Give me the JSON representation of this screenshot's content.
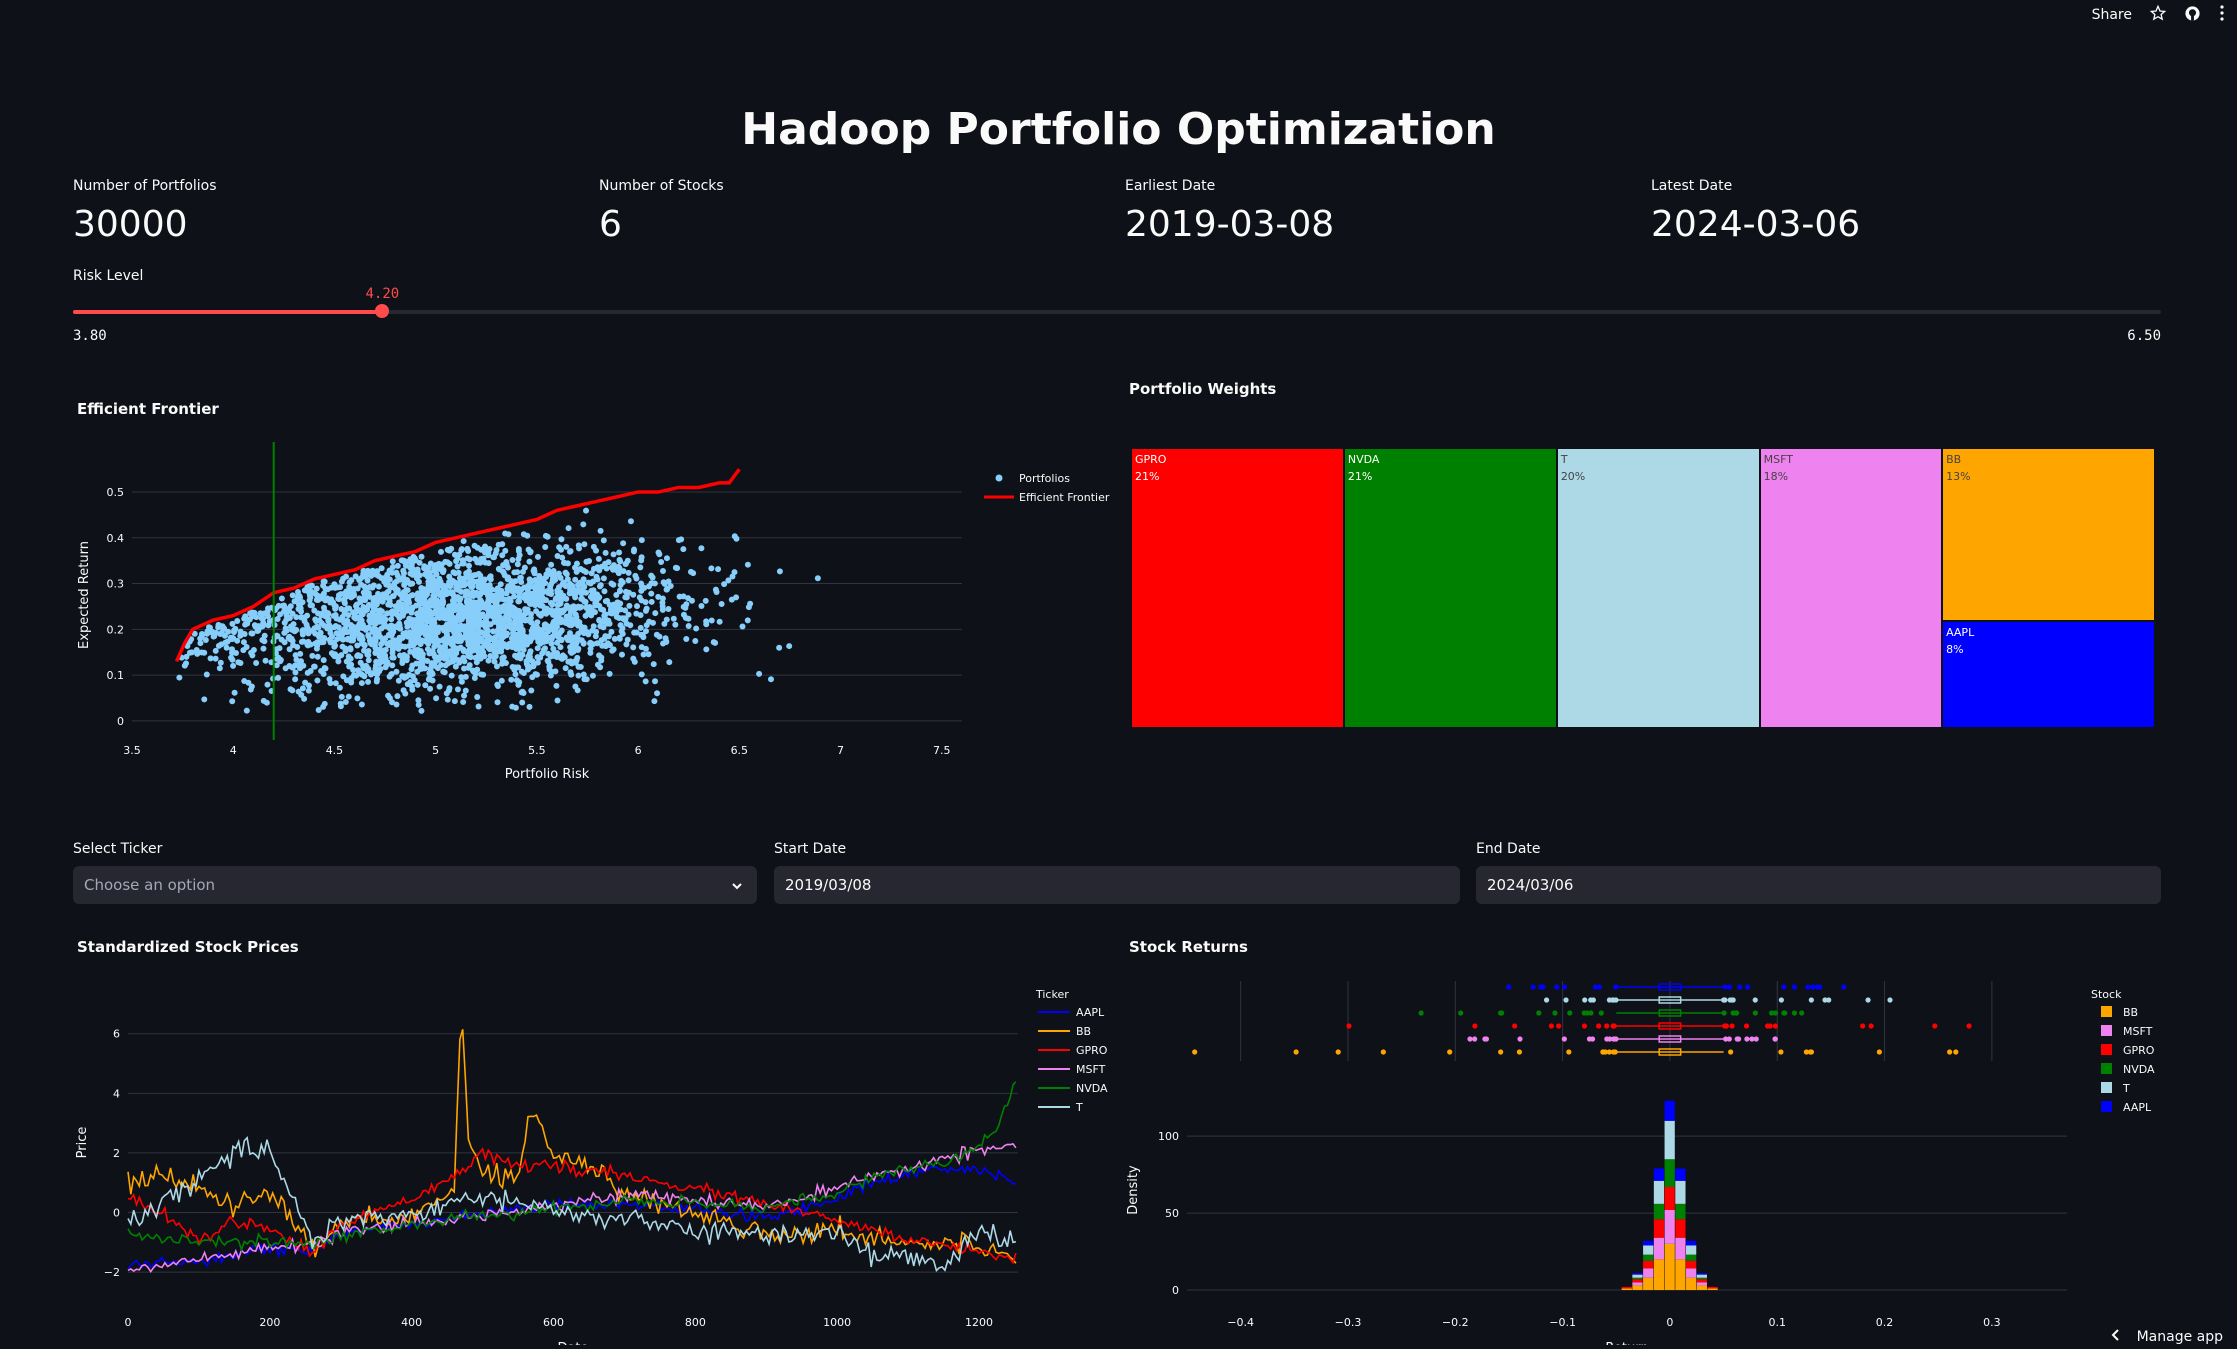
{
  "topbar": {
    "share": "Share",
    "star_icon": "star-icon",
    "github_icon": "github-icon",
    "menu_icon": "kebab-menu-icon"
  },
  "title": "Hadoop Portfolio Optimization",
  "metrics": [
    {
      "label": "Number of Portfolios",
      "value": "30000"
    },
    {
      "label": "Number of Stocks",
      "value": "6"
    },
    {
      "label": "Earliest Date",
      "value": "2019-03-08"
    },
    {
      "label": "Latest Date",
      "value": "2024-03-06"
    }
  ],
  "slider": {
    "label": "Risk Level",
    "min": "3.80",
    "max": "6.50",
    "value": "4.20",
    "value_num": 4.2,
    "min_num": 3.8,
    "max_num": 6.5
  },
  "efficient_frontier": {
    "title": "Efficient Frontier"
  },
  "portfolio_weights": {
    "title": "Portfolio Weights"
  },
  "controls": {
    "ticker_label": "Select Ticker",
    "ticker_placeholder": "Choose an option",
    "start_label": "Start Date",
    "start_value": "2019/03/08",
    "end_label": "End Date",
    "end_value": "2024/03/06"
  },
  "prices": {
    "title": "Standardized Stock Prices"
  },
  "returns": {
    "title": "Stock Returns"
  },
  "footer": {
    "manage": "Manage app"
  },
  "colors": {
    "AAPL": "#0000ff",
    "BB": "#ffa500",
    "GPRO": "#ff0000",
    "MSFT": "#ee82ee",
    "NVDA": "#008000",
    "T": "#add8e6",
    "accent": "#ff4b4b",
    "portfolio": "#87cefa"
  },
  "chart_data": [
    {
      "type": "scatter",
      "title": "",
      "xlabel": "Portfolio Risk",
      "ylabel": "Expected Return",
      "xlim": [
        3.5,
        7.6
      ],
      "ylim": [
        -0.02,
        0.57
      ],
      "xticks": [
        "3.5",
        "4",
        "4.5",
        "5",
        "5.5",
        "6",
        "6.5",
        "7",
        "7.5"
      ],
      "yticks": [
        "0",
        "0.1",
        "0.2",
        "0.3",
        "0.4",
        "0.5"
      ],
      "legend": [
        "Portfolios",
        "Efficient Frontier"
      ],
      "legend_position": "top-right",
      "vline_x": 4.2,
      "frontier": {
        "x": [
          3.72,
          3.76,
          3.8,
          3.9,
          4.0,
          4.1,
          4.2,
          4.3,
          4.4,
          4.5,
          4.6,
          4.7,
          4.8,
          4.9,
          5.0,
          5.1,
          5.2,
          5.3,
          5.4,
          5.5,
          5.6,
          5.7,
          5.8,
          5.9,
          6.0,
          6.1,
          6.2,
          6.3,
          6.4,
          6.45,
          6.5
        ],
        "y": [
          0.13,
          0.17,
          0.2,
          0.22,
          0.23,
          0.25,
          0.28,
          0.29,
          0.31,
          0.32,
          0.33,
          0.35,
          0.36,
          0.37,
          0.39,
          0.4,
          0.41,
          0.42,
          0.43,
          0.44,
          0.46,
          0.47,
          0.48,
          0.49,
          0.5,
          0.5,
          0.51,
          0.51,
          0.52,
          0.52,
          0.55
        ]
      },
      "series": [
        {
          "name": "Portfolios",
          "values": "30000 random portfolios (risk 3.7–7.4, return 0.0–0.5)"
        }
      ]
    },
    {
      "type": "treemap",
      "labels": [
        "GPRO",
        "NVDA",
        "T",
        "MSFT",
        "BB",
        "AAPL"
      ],
      "values": [
        21,
        21,
        20,
        18,
        13,
        8
      ],
      "value_labels": [
        "21%",
        "21%",
        "20%",
        "18%",
        "13%",
        "8%"
      ]
    },
    {
      "type": "line",
      "title": "",
      "xlabel": "Date",
      "ylabel": "Price",
      "xlim": [
        0,
        1255
      ],
      "ylim": [
        -2.6,
        7.3
      ],
      "xticks": [
        "0",
        "200",
        "400",
        "600",
        "800",
        "1000",
        "1200"
      ],
      "yticks": [
        "−2",
        "0",
        "2",
        "4",
        "6"
      ],
      "legend_title": "Ticker",
      "series": [
        {
          "name": "AAPL",
          "x": [
            0,
            100,
            200,
            260,
            300,
            400,
            500,
            600,
            700,
            800,
            900,
            1000,
            1050,
            1100,
            1150,
            1200,
            1250
          ],
          "y": [
            -1.8,
            -1.6,
            -1.2,
            -1.3,
            -0.7,
            -0.4,
            0,
            0.3,
            0.3,
            0.1,
            -0.2,
            0.5,
            1.0,
            1.3,
            1.5,
            1.4,
            1.1
          ]
        },
        {
          "name": "BB",
          "x": [
            0,
            50,
            100,
            150,
            200,
            240,
            260,
            300,
            400,
            460,
            470,
            480,
            500,
            550,
            570,
            600,
            650,
            700,
            800,
            900,
            1000,
            1100,
            1200,
            1250
          ],
          "y": [
            1.0,
            1.2,
            0.8,
            0.2,
            0.7,
            -0.5,
            -1.4,
            -0.3,
            -0.2,
            0.8,
            7.0,
            2.5,
            1.5,
            1.2,
            3.5,
            2.0,
            1.6,
            0.6,
            0.0,
            -0.7,
            -0.6,
            -1.0,
            -1.1,
            -1.5
          ]
        },
        {
          "name": "GPRO",
          "x": [
            0,
            50,
            100,
            150,
            200,
            260,
            300,
            400,
            450,
            500,
            550,
            600,
            700,
            800,
            900,
            1000,
            1100,
            1200,
            1250
          ],
          "y": [
            0.5,
            0.0,
            -0.9,
            -0.3,
            -0.5,
            -1.4,
            -0.4,
            0.5,
            1.1,
            2.0,
            1.5,
            1.6,
            1.2,
            0.8,
            0.3,
            -0.3,
            -0.9,
            -1.3,
            -1.5
          ]
        },
        {
          "name": "MSFT",
          "x": [
            0,
            100,
            200,
            260,
            300,
            400,
            500,
            600,
            700,
            800,
            900,
            1000,
            1100,
            1150,
            1200,
            1250
          ],
          "y": [
            -1.9,
            -1.6,
            -1.2,
            -1.1,
            -0.7,
            -0.4,
            -0.1,
            0.3,
            0.6,
            0.4,
            0.2,
            0.8,
            1.5,
            1.8,
            2.1,
            2.3
          ]
        },
        {
          "name": "NVDA",
          "x": [
            0,
            100,
            200,
            260,
            300,
            400,
            500,
            600,
            700,
            800,
            900,
            1000,
            1050,
            1100,
            1150,
            1200,
            1230,
            1250
          ],
          "y": [
            -0.8,
            -1.0,
            -1.0,
            -1.0,
            -0.8,
            -0.4,
            -0.1,
            0.1,
            0.4,
            0.3,
            0.2,
            0.6,
            1.2,
            1.5,
            1.6,
            2.2,
            3.0,
            4.3
          ]
        },
        {
          "name": "T",
          "x": [
            0,
            50,
            100,
            150,
            200,
            250,
            260,
            300,
            400,
            500,
            600,
            700,
            800,
            900,
            1000,
            1050,
            1100,
            1150,
            1200,
            1250
          ],
          "y": [
            -0.5,
            0.5,
            1.0,
            2.0,
            2.2,
            -0.4,
            -1.0,
            -0.2,
            -0.1,
            0.6,
            0.0,
            -0.2,
            -0.6,
            -0.8,
            -0.6,
            -1.4,
            -1.5,
            -1.8,
            -0.7,
            -0.9
          ]
        }
      ]
    },
    {
      "type": "histogram",
      "title": "",
      "xlabel": "Return",
      "ylabel": "Density",
      "xlim": [
        -0.45,
        0.37
      ],
      "ylim": [
        0,
        130
      ],
      "xticks": [
        "−0.4",
        "−0.3",
        "−0.2",
        "−0.1",
        "0",
        "0.1",
        "0.2",
        "0.3"
      ],
      "yticks": [
        "0",
        "50",
        "100"
      ],
      "legend_title": "Stock",
      "legend": [
        "BB",
        "MSFT",
        "GPRO",
        "NVDA",
        "T",
        "AAPL"
      ],
      "bins": [
        -0.04,
        -0.03,
        -0.02,
        -0.01,
        0.0,
        0.01,
        0.02,
        0.03,
        0.04
      ],
      "stacked": {
        "BB": [
          1,
          3,
          8,
          20,
          30,
          20,
          8,
          3,
          1
        ],
        "MSFT": [
          0,
          2,
          6,
          14,
          22,
          14,
          6,
          2,
          0
        ],
        "GPRO": [
          1,
          2,
          5,
          12,
          15,
          12,
          5,
          2,
          1
        ],
        "NVDA": [
          0,
          1,
          4,
          10,
          18,
          10,
          4,
          1,
          0
        ],
        "T": [
          0,
          2,
          6,
          15,
          25,
          15,
          6,
          2,
          0
        ],
        "AAPL": [
          0,
          1,
          3,
          8,
          13,
          8,
          3,
          1,
          0
        ]
      }
    }
  ]
}
